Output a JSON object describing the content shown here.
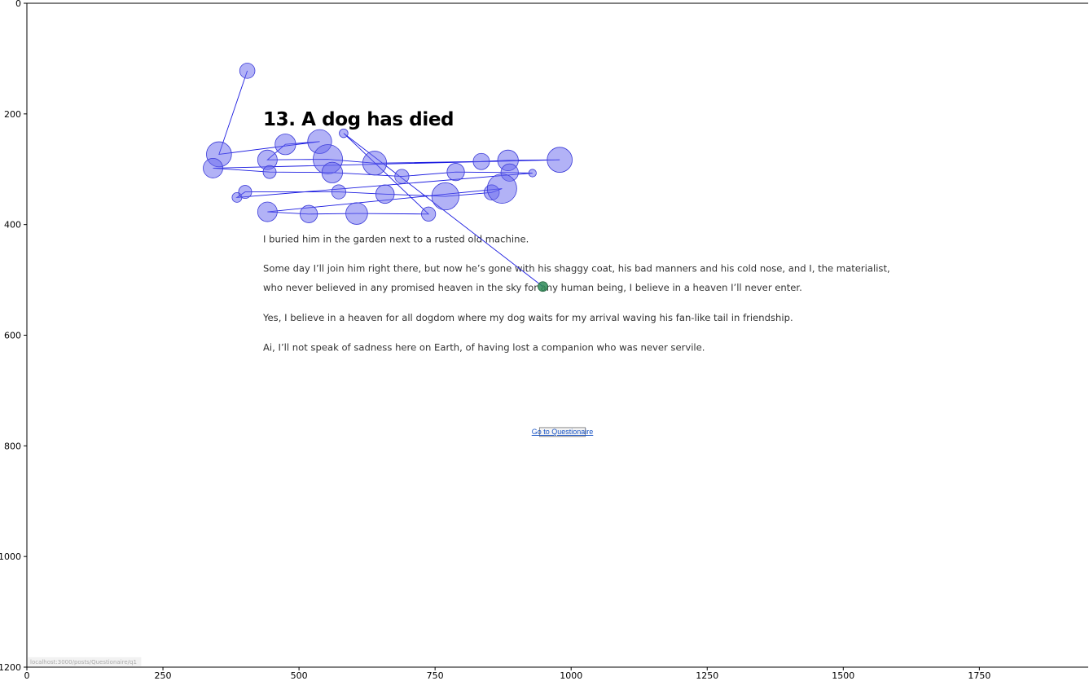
{
  "chart_data": {
    "type": "scatter",
    "xlim": [
      0,
      1950
    ],
    "ylim": [
      1200,
      0
    ],
    "x_ticks": [
      0,
      250,
      500,
      750,
      1000,
      1250,
      1500,
      1750
    ],
    "y_ticks": [
      0,
      200,
      400,
      600,
      800,
      1000,
      1200
    ],
    "grid": false,
    "page": {
      "title": "13. A dog has died",
      "paragraphs": [
        [
          "I buried him in the garden next to a rusted old machine."
        ],
        [
          "Some day I’ll join him right there, but now he’s gone with his shaggy coat, his bad manners and his cold nose, and I, the materialist,",
          "who never believed in any promised heaven in the sky for any human being, I believe in a heaven I’ll never enter."
        ],
        [
          "Yes, I believe in a heaven for all dogdom where my dog waits for my arrival waving his fan-like tail in friendship."
        ],
        [
          "Ai, I’ll not speak of sadness here on Earth, of having lost a companion who was never servile."
        ]
      ],
      "button_label": "Go to Questionaire",
      "status_url": "localhost:3000/posts/Questionaire/q1"
    },
    "gaze_color": "#6666ee",
    "current_color": "#2e8b57",
    "fixations": [
      {
        "x": 405,
        "y": 122,
        "r": 14
      },
      {
        "x": 353,
        "y": 273,
        "r": 23
      },
      {
        "x": 475,
        "y": 255,
        "r": 19
      },
      {
        "x": 538,
        "y": 250,
        "r": 22
      },
      {
        "x": 442,
        "y": 283,
        "r": 18
      },
      {
        "x": 553,
        "y": 282,
        "r": 27
      },
      {
        "x": 639,
        "y": 289,
        "r": 22
      },
      {
        "x": 835,
        "y": 286,
        "r": 15
      },
      {
        "x": 884,
        "y": 284,
        "r": 19
      },
      {
        "x": 979,
        "y": 283,
        "r": 23
      },
      {
        "x": 342,
        "y": 298,
        "r": 18
      },
      {
        "x": 446,
        "y": 305,
        "r": 12
      },
      {
        "x": 561,
        "y": 306,
        "r": 19
      },
      {
        "x": 689,
        "y": 313,
        "r": 13
      },
      {
        "x": 788,
        "y": 305,
        "r": 16
      },
      {
        "x": 887,
        "y": 306,
        "r": 16
      },
      {
        "x": 929,
        "y": 307,
        "r": 7
      },
      {
        "x": 386,
        "y": 351,
        "r": 9
      },
      {
        "x": 401,
        "y": 341,
        "r": 12
      },
      {
        "x": 573,
        "y": 341,
        "r": 13
      },
      {
        "x": 658,
        "y": 345,
        "r": 17
      },
      {
        "x": 769,
        "y": 349,
        "r": 25
      },
      {
        "x": 854,
        "y": 342,
        "r": 14
      },
      {
        "x": 873,
        "y": 335,
        "r": 27
      },
      {
        "x": 442,
        "y": 377,
        "r": 18
      },
      {
        "x": 518,
        "y": 381,
        "r": 16
      },
      {
        "x": 606,
        "y": 380,
        "r": 20
      },
      {
        "x": 738,
        "y": 381,
        "r": 13
      },
      {
        "x": 582,
        "y": 235,
        "r": 8
      },
      {
        "x": 948,
        "y": 512,
        "r": 9,
        "current": true
      }
    ],
    "scanpath": [
      [
        405,
        122
      ],
      [
        353,
        273
      ],
      [
        538,
        250
      ],
      [
        475,
        255
      ],
      [
        442,
        283
      ],
      [
        553,
        282
      ],
      [
        639,
        289
      ],
      [
        835,
        286
      ],
      [
        884,
        284
      ],
      [
        979,
        283
      ],
      [
        342,
        298
      ],
      [
        446,
        305
      ],
      [
        561,
        306
      ],
      [
        689,
        313
      ],
      [
        788,
        305
      ],
      [
        887,
        306
      ],
      [
        929,
        307
      ],
      [
        386,
        351
      ],
      [
        401,
        341
      ],
      [
        573,
        341
      ],
      [
        658,
        345
      ],
      [
        769,
        349
      ],
      [
        854,
        342
      ],
      [
        873,
        335
      ],
      [
        442,
        377
      ],
      [
        518,
        381
      ],
      [
        606,
        380
      ],
      [
        738,
        381
      ],
      [
        582,
        235
      ],
      [
        948,
        512
      ]
    ]
  }
}
